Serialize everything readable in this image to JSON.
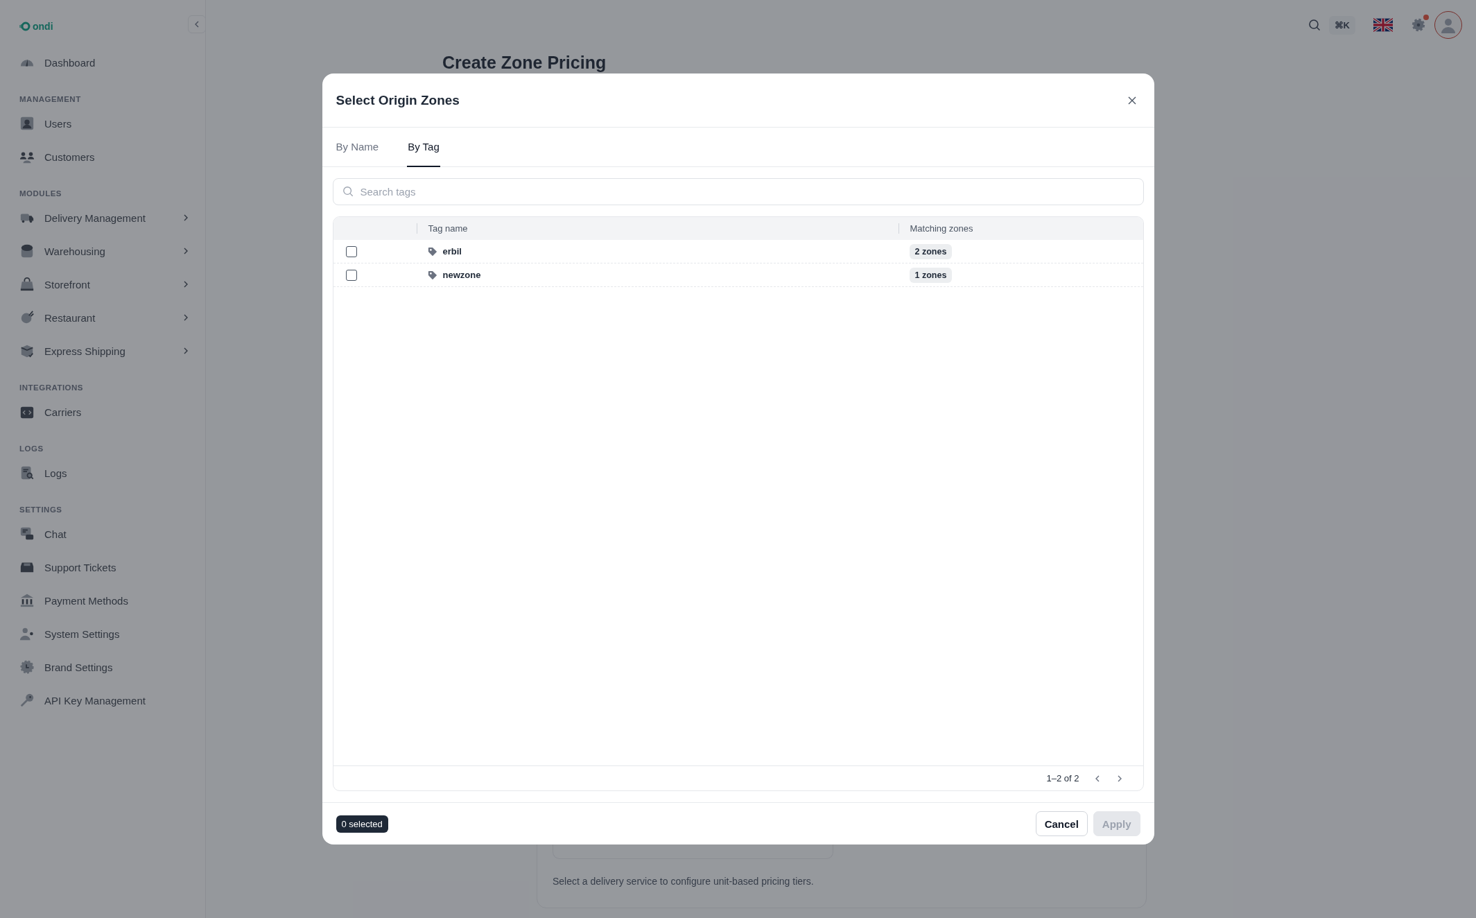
{
  "sidebar": {
    "logo": "ondi",
    "sections": [
      {
        "items": [
          {
            "label": "Dashboard",
            "kind": "link"
          }
        ]
      },
      {
        "heading": "MANAGEMENT",
        "items": [
          {
            "label": "Users",
            "kind": "link"
          },
          {
            "label": "Customers",
            "kind": "link"
          }
        ]
      },
      {
        "heading": "MODULES",
        "items": [
          {
            "label": "Delivery Management",
            "kind": "group"
          },
          {
            "label": "Warehousing",
            "kind": "group"
          },
          {
            "label": "Storefront",
            "kind": "group"
          },
          {
            "label": "Restaurant",
            "kind": "group"
          },
          {
            "label": "Express Shipping",
            "kind": "group"
          }
        ]
      },
      {
        "heading": "INTEGRATIONS",
        "items": [
          {
            "label": "Carriers",
            "kind": "link"
          }
        ]
      },
      {
        "heading": "LOGS",
        "items": [
          {
            "label": "Logs",
            "kind": "link"
          }
        ]
      },
      {
        "heading": "SETTINGS",
        "items": [
          {
            "label": "Chat",
            "kind": "link"
          },
          {
            "label": "Support Tickets",
            "kind": "link"
          },
          {
            "label": "Payment Methods",
            "kind": "link"
          },
          {
            "label": "System Settings",
            "kind": "link"
          },
          {
            "label": "Brand Settings",
            "kind": "link"
          },
          {
            "label": "API Key Management",
            "kind": "link"
          }
        ]
      }
    ]
  },
  "topbar": {
    "shortcut": "⌘K",
    "has_notification": true
  },
  "page": {
    "title": "Create Zone Pricing",
    "hint": "Select a delivery service to configure unit-based pricing tiers."
  },
  "modal": {
    "title": "Select Origin Zones",
    "tabs": [
      {
        "label": "By Name",
        "selected": false
      },
      {
        "label": "By Tag",
        "selected": true
      }
    ],
    "search": {
      "placeholder": "Search tags"
    },
    "columns": [
      "Tag name",
      "Matching zones"
    ],
    "rows": [
      {
        "checked": false,
        "tag": "erbil",
        "zones": "2 zones"
      },
      {
        "checked": false,
        "tag": "newzone",
        "zones": "1 zones"
      }
    ],
    "pagination": "1–2 of 2",
    "selection_count": "0 selected",
    "buttons": [
      {
        "label": "Cancel",
        "kind": "secondary",
        "disabled": false
      },
      {
        "label": "Apply",
        "kind": "primary",
        "disabled": true
      }
    ]
  }
}
